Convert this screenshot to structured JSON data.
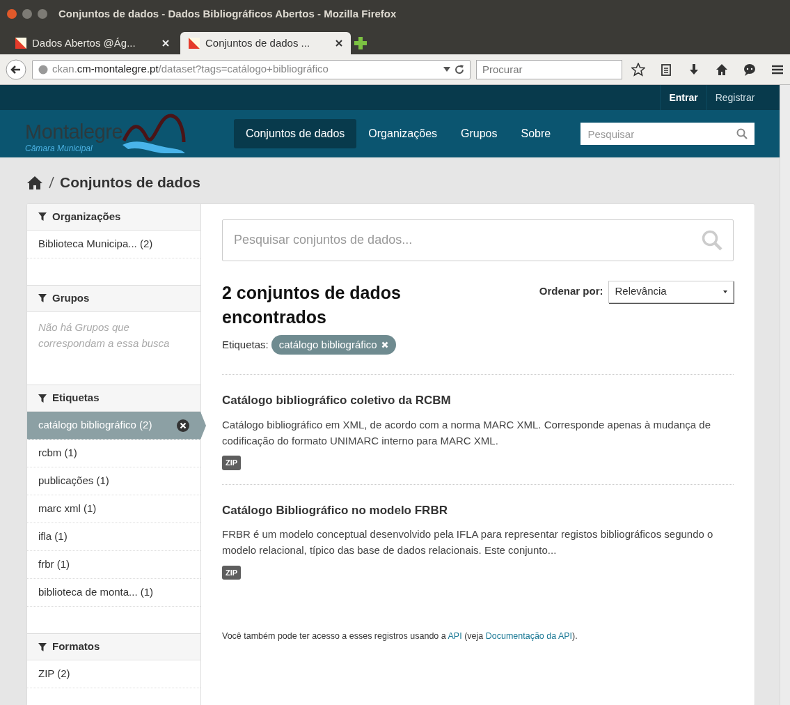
{
  "browser": {
    "window_title": "Conjuntos de dados - Dados Bibliográficos Abertos - Mozilla Firefox",
    "tabs": [
      {
        "label": "Dados Abertos @Ág...",
        "selected": false
      },
      {
        "label": "Conjuntos de dados ...",
        "selected": true
      }
    ],
    "url": {
      "subdomain": "ckan.",
      "domain": "cm-montalegre.pt",
      "path": "/dataset?tags=catálogo+bibliográfico"
    },
    "search": {
      "placeholder": "Procurar"
    }
  },
  "site": {
    "account_links": [
      {
        "label": "Entrar",
        "bold": true
      },
      {
        "label": "Registrar",
        "bold": false
      }
    ],
    "logo": {
      "name": "Montalegre",
      "subtitle": "Câmara Municipal"
    },
    "nav": [
      {
        "label": "Conjuntos de dados",
        "selected": true
      },
      {
        "label": "Organizações",
        "selected": false
      },
      {
        "label": "Grupos",
        "selected": false
      },
      {
        "label": "Sobre",
        "selected": false
      }
    ],
    "search": {
      "placeholder": "Pesquisar"
    }
  },
  "breadcrumb": "Conjuntos de dados",
  "facets": [
    {
      "title": "Organizações",
      "items": [
        {
          "label": "Biblioteca Municipa... (2)",
          "selected": false
        }
      ]
    },
    {
      "title": "Grupos",
      "message": "Não há Grupos que correspondam a essa busca"
    },
    {
      "title": "Etiquetas",
      "items": [
        {
          "label": "catálogo bibliográfico (2)",
          "selected": true
        },
        {
          "label": "rcbm (1)",
          "selected": false
        },
        {
          "label": "publicações (1)",
          "selected": false
        },
        {
          "label": "marc xml (1)",
          "selected": false
        },
        {
          "label": "ifla (1)",
          "selected": false
        },
        {
          "label": "frbr (1)",
          "selected": false
        },
        {
          "label": "biblioteca de monta... (1)",
          "selected": false
        }
      ]
    },
    {
      "title": "Formatos",
      "items": [
        {
          "label": "ZIP (2)",
          "selected": false
        }
      ]
    }
  ],
  "main": {
    "search": {
      "placeholder": "Pesquisar conjuntos de dados..."
    },
    "heading": "2 conjuntos de dados encontrados",
    "sort": {
      "label": "Ordenar por:",
      "value": "Relevância"
    },
    "filter": {
      "label": "Etiquetas:",
      "tag": "catálogo bibliográfico"
    },
    "datasets": [
      {
        "title": "Catálogo bibliográfico coletivo da RCBM",
        "description": "Catálogo bibliográfico em XML, de acordo com a norma MARC XML. Corresponde apenas à mudança de codificação do formato UNIMARC interno para MARC XML.",
        "formats": [
          "ZIP"
        ]
      },
      {
        "title": "Catálogo Bibliográfico no modelo FRBR",
        "description": "FRBR é um modelo conceptual desenvolvido pela IFLA para representar registos bibliográficos segundo o modelo relacional, típico das base de dados relacionais. Este conjunto...",
        "formats": [
          "ZIP"
        ]
      }
    ],
    "api_note": {
      "text_before": "Você também pode ter acesso a esses registros usando a ",
      "api_link": "API",
      "text_middle": " (veja ",
      "docs_link": "Documentação da API",
      "text_after": ")."
    }
  }
}
